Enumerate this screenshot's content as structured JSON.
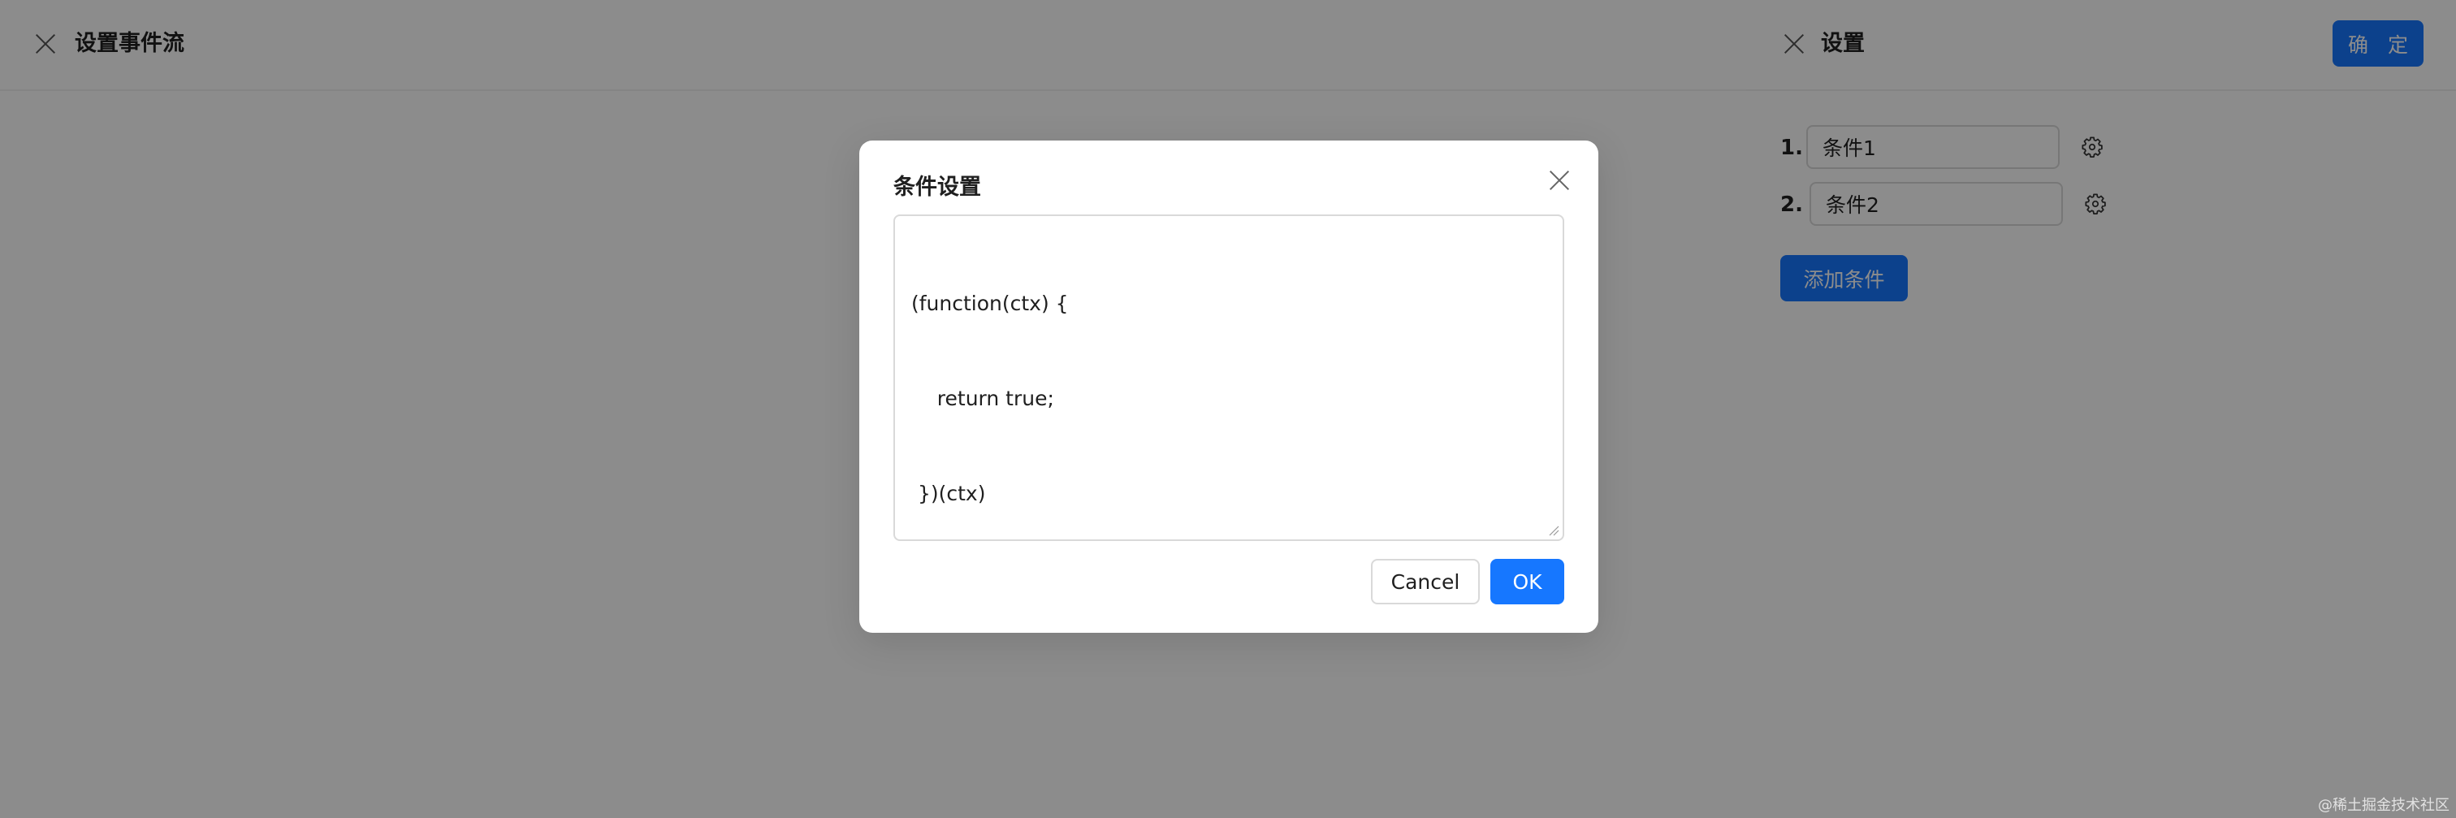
{
  "page": {
    "title": "设置事件流"
  },
  "drawer": {
    "title": "设置",
    "confirm_label": "确 定",
    "conditions": [
      {
        "index": "1.",
        "value": "条件1"
      },
      {
        "index": "2.",
        "value": "条件2"
      }
    ],
    "add_label": "添加条件"
  },
  "modal": {
    "title": "条件设置",
    "code_lines": [
      "(function(ctx) {",
      "    return true;",
      " })(ctx)"
    ],
    "cancel_label": "Cancel",
    "ok_label": "OK"
  },
  "watermark": "@稀土掘金技术社区",
  "colors": {
    "primary": "#1677ff",
    "overlay": "rgba(0,0,0,0.45)",
    "border": "#d9d9d9"
  },
  "icons": {
    "close": "close-icon",
    "settings": "gear-icon"
  }
}
